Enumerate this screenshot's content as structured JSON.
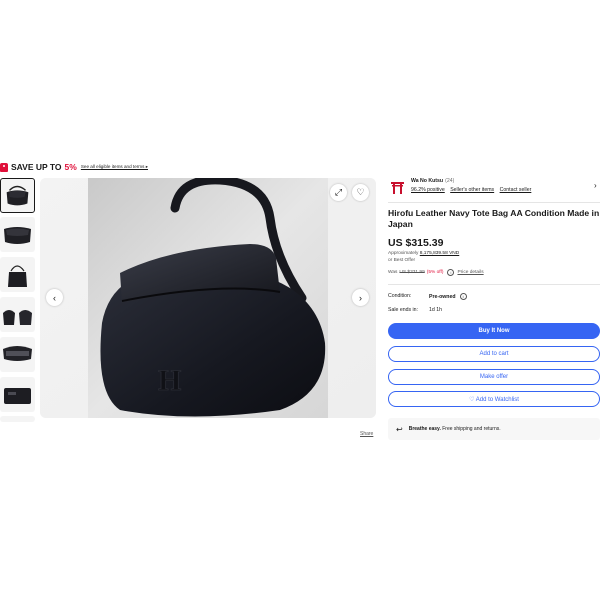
{
  "promo": {
    "save_text": "SAVE UP TO",
    "save_percent": "5%",
    "link_text": "See all eligible items and terms ▸",
    "accent_color": "#e0103a"
  },
  "gallery": {
    "thumbnail_count": 7,
    "selected_index": 0,
    "share_label": "Share"
  },
  "seller": {
    "name": "Wa No Kutsu",
    "feedback_count": "(24)",
    "positive": "96.2% positive",
    "other_items": "Seller's other items",
    "contact": "Contact seller"
  },
  "listing": {
    "title": "Hirofu Leather Navy Tote Bag AA Condition Made in Japan",
    "price": "US $315.39",
    "approx_label": "Approximately",
    "approx_value": "8,175,839.58 VND",
    "best_offer": "or Best Offer",
    "was_label": "Was",
    "was_price": "US $331.99",
    "discount": "(5% off)",
    "price_details": "Price details",
    "condition_label": "Condition:",
    "condition_value": "Pre-owned",
    "sale_ends_label": "Sale ends in:",
    "sale_ends_value": "1d 1h"
  },
  "actions": {
    "buy_now": "Buy It Now",
    "add_to_cart": "Add to cart",
    "make_offer": "Make offer",
    "add_to_watchlist": "♡ Add to Watchlist",
    "primary_color": "#3665f3"
  },
  "returns": {
    "bold": "Breathe easy.",
    "text": "Free shipping and returns."
  }
}
